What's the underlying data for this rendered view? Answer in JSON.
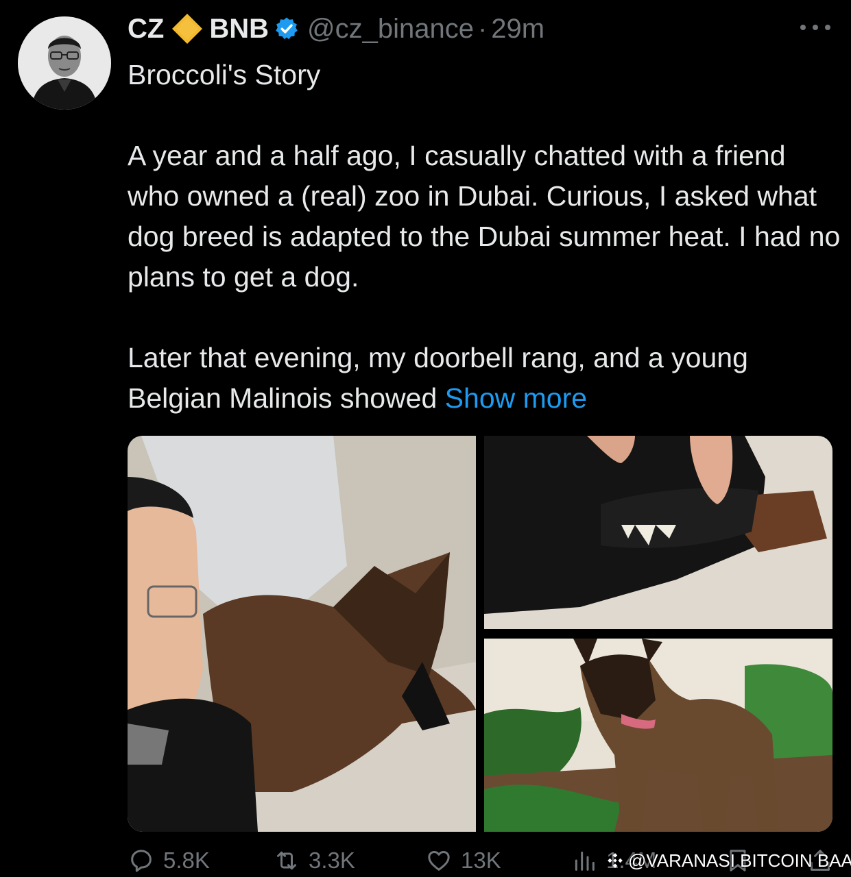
{
  "author": {
    "name": "CZ",
    "badge_label": "BNB",
    "handle": "@cz_binance",
    "separator": "·",
    "time": "29m"
  },
  "tweet": {
    "paragraph1": "Broccoli's Story",
    "paragraph2": "A year and a half ago, I casually chatted with a friend who owned a (real) zoo in Dubai. Curious, I asked what dog breed is adapted to the Dubai summer heat. I had no plans to get a dog.",
    "paragraph3": "Later that evening, my doorbell rang, and a young Belgian Malinois showed",
    "show_more": "Show more"
  },
  "media": {
    "photos": [
      "selfie-with-dog",
      "dog-teeth-closeup",
      "dog-standing-in-garden"
    ]
  },
  "actions": {
    "replies": "5.8K",
    "reposts": "3.3K",
    "likes": "13K",
    "views": "1.4M"
  },
  "watermark": {
    "text": "@VARANASI BITCOIN BAA..."
  },
  "colors": {
    "background": "#000000",
    "text": "#e7e9ea",
    "muted": "#71767b",
    "link": "#1d9bf0",
    "bnb": "#f3ba2f",
    "verified": "#1d9bf0"
  },
  "icons": [
    "more-icon",
    "bnb-diamond-icon",
    "verified-icon",
    "reply-icon",
    "retweet-icon",
    "like-icon",
    "views-icon",
    "bookmark-icon",
    "share-icon",
    "binance-logo-icon"
  ]
}
